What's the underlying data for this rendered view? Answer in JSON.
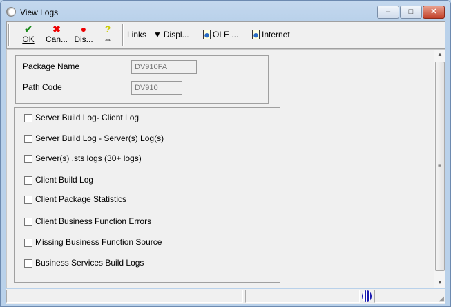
{
  "window": {
    "title": "View Logs",
    "minimize": "–",
    "maximize": "□",
    "close": "✕"
  },
  "toolbar": {
    "ok": "OK",
    "cancel": "Can...",
    "display": "Dis...",
    "help": "⇔",
    "links": "Links",
    "displ": "Displ...",
    "ole": "OLE ...",
    "internet": "Internet"
  },
  "package": {
    "name_label": "Package Name",
    "name_value": "DV910FA",
    "path_label": "Path Code",
    "path_value": "DV910"
  },
  "logs": [
    {
      "label": "Server Build Log- Client Log",
      "checked": false
    },
    {
      "label": "Server Build Log - Server(s) Log(s)",
      "checked": false
    },
    {
      "label": "Server(s) .sts logs (30+ logs)",
      "checked": false
    },
    {
      "label": "Client Build Log",
      "checked": false
    },
    {
      "label": "Client Package Statistics",
      "checked": false
    },
    {
      "label": "Client Business Function Errors",
      "checked": false
    },
    {
      "label": "Missing Business Function Source",
      "checked": false
    },
    {
      "label": "Business Services Build Logs",
      "checked": false
    }
  ]
}
